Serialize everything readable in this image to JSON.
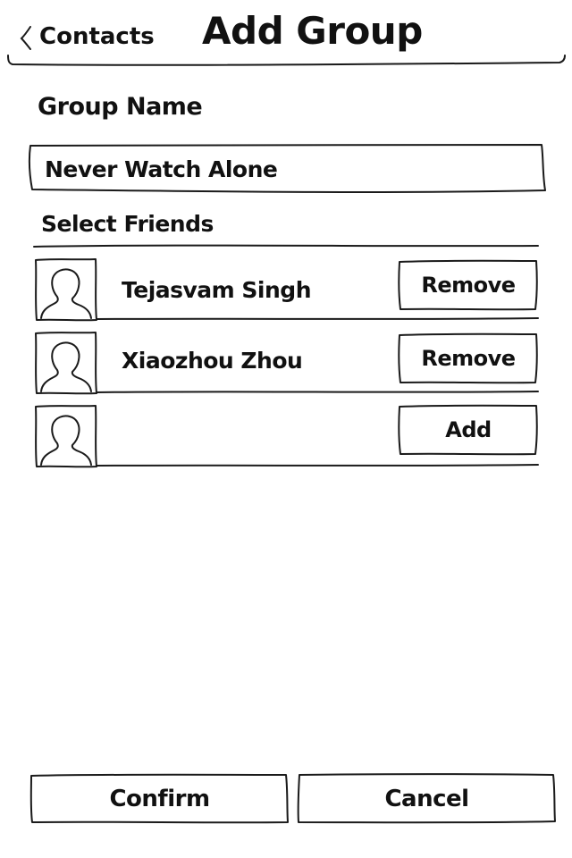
{
  "nav": {
    "back_label": "Contacts",
    "title": "Add Group"
  },
  "group_name": {
    "label": "Group Name",
    "value": "Never Watch Alone"
  },
  "friends": {
    "label": "Select Friends",
    "rows": [
      {
        "name": "Tejasvam Singh",
        "action": "Remove"
      },
      {
        "name": "Xiaozhou Zhou",
        "action": "Remove"
      },
      {
        "name": "",
        "action": "Add"
      }
    ]
  },
  "footer": {
    "confirm_label": "Confirm",
    "cancel_label": "Cancel"
  }
}
